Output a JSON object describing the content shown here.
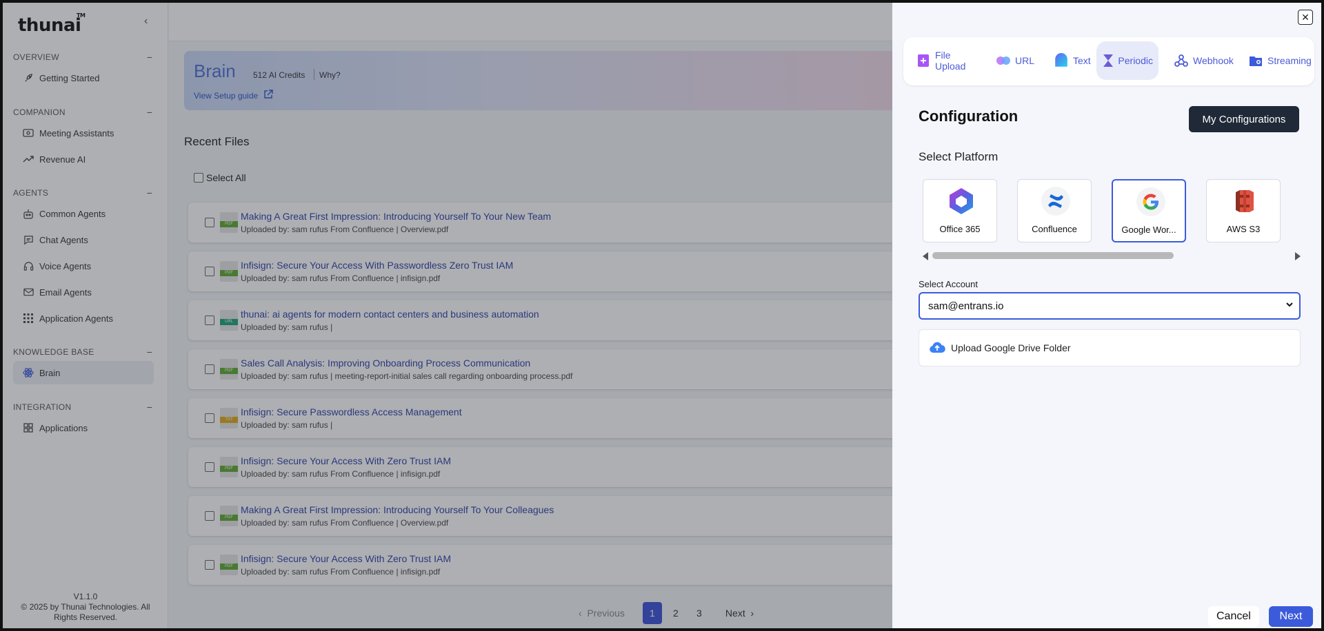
{
  "app": {
    "logo": "thunai",
    "tm": "TM",
    "version": "V1.1.0",
    "copyright": "© 2025 by Thunai Technologies. All Rights Reserved."
  },
  "sidebar": {
    "sections": [
      {
        "title": "OVERVIEW",
        "items": [
          {
            "label": "Getting Started",
            "icon": "rocket-icon"
          }
        ]
      },
      {
        "title": "COMPANION",
        "items": [
          {
            "label": "Meeting Assistants",
            "icon": "video-icon"
          },
          {
            "label": "Revenue AI",
            "icon": "trend-icon"
          }
        ]
      },
      {
        "title": "AGENTS",
        "items": [
          {
            "label": "Common Agents",
            "icon": "robot-icon"
          },
          {
            "label": "Chat Agents",
            "icon": "chat-icon"
          },
          {
            "label": "Voice Agents",
            "icon": "headset-icon"
          },
          {
            "label": "Email Agents",
            "icon": "mail-icon"
          },
          {
            "label": "Application Agents",
            "icon": "grid-icon"
          }
        ]
      },
      {
        "title": "KNOWLEDGE BASE",
        "items": [
          {
            "label": "Brain",
            "icon": "atom-icon",
            "active": true
          }
        ]
      },
      {
        "title": "INTEGRATION",
        "items": [
          {
            "label": "Applications",
            "icon": "apps-icon"
          }
        ]
      }
    ]
  },
  "banner": {
    "title": "Brain",
    "credits": "512 AI Credits",
    "why": "Why?",
    "guide": "View Setup guide"
  },
  "recent": {
    "title": "Recent Files",
    "select_all": "Select All",
    "files": [
      {
        "title": "Making A Great First Impression: Introducing Yourself To Your New Team",
        "meta": "Uploaded by: sam rufus From Confluence | Overview.pdf",
        "type": "PDF"
      },
      {
        "title": "Infisign: Secure Your Access With Passwordless Zero Trust IAM",
        "meta": "Uploaded by: sam rufus From Confluence | infisign.pdf",
        "type": "PDF"
      },
      {
        "title": "thunai: ai agents for modern contact centers and business automation",
        "meta": "Uploaded by: sam rufus |",
        "type": "URL"
      },
      {
        "title": "Sales Call Analysis: Improving Onboarding Process Communication",
        "meta": "Uploaded by: sam rufus | meeting-report-initial sales call regarding onboarding process.pdf",
        "type": "PDF"
      },
      {
        "title": "Infisign: Secure Passwordless Access Management",
        "meta": "Uploaded by: sam rufus |",
        "type": "TXT"
      },
      {
        "title": "Infisign: Secure Your Access With Zero Trust IAM",
        "meta": "Uploaded by: sam rufus From Confluence | infisign.pdf",
        "type": "PDF"
      },
      {
        "title": "Making A Great First Impression: Introducing Yourself To Your Colleagues",
        "meta": "Uploaded by: sam rufus From Confluence | Overview.pdf",
        "type": "PDF"
      },
      {
        "title": "Infisign: Secure Your Access With Zero Trust IAM",
        "meta": "Uploaded by: sam rufus From Confluence | infisign.pdf",
        "type": "PDF"
      }
    ]
  },
  "pagination": {
    "previous": "Previous",
    "pages": [
      "1",
      "2",
      "3"
    ],
    "current": "1",
    "next": "Next"
  },
  "panel": {
    "tabs": [
      {
        "label": "File Upload",
        "icon": "file-upload-icon"
      },
      {
        "label": "URL",
        "icon": "link-icon"
      },
      {
        "label": "Text",
        "icon": "text-icon"
      },
      {
        "label": "Periodic",
        "icon": "hourglass-icon",
        "active": true
      },
      {
        "label": "Webhook",
        "icon": "webhook-icon"
      },
      {
        "label": "Streaming",
        "icon": "streaming-icon"
      }
    ],
    "configuration_title": "Configuration",
    "my_configurations": "My Configurations",
    "select_platform": "Select Platform",
    "platforms": [
      {
        "name": "Office 365",
        "icon": "office365-icon"
      },
      {
        "name": "Confluence",
        "icon": "confluence-icon"
      },
      {
        "name": "Google Wor...",
        "icon": "google-icon",
        "active": true
      },
      {
        "name": "AWS S3",
        "icon": "aws-s3-icon"
      }
    ],
    "select_account_label": "Select Account",
    "account_value": "sam@entrans.io",
    "upload_folder": "Upload Google Drive Folder",
    "cancel": "Cancel",
    "next": "Next"
  },
  "colors": {
    "accent": "#3b5bdb",
    "dark_button": "#1f2937",
    "link": "#2e3fa8",
    "pdf_badge": "#5ea832",
    "url_badge": "#1aa37a",
    "txt_badge": "#e0a81a"
  }
}
